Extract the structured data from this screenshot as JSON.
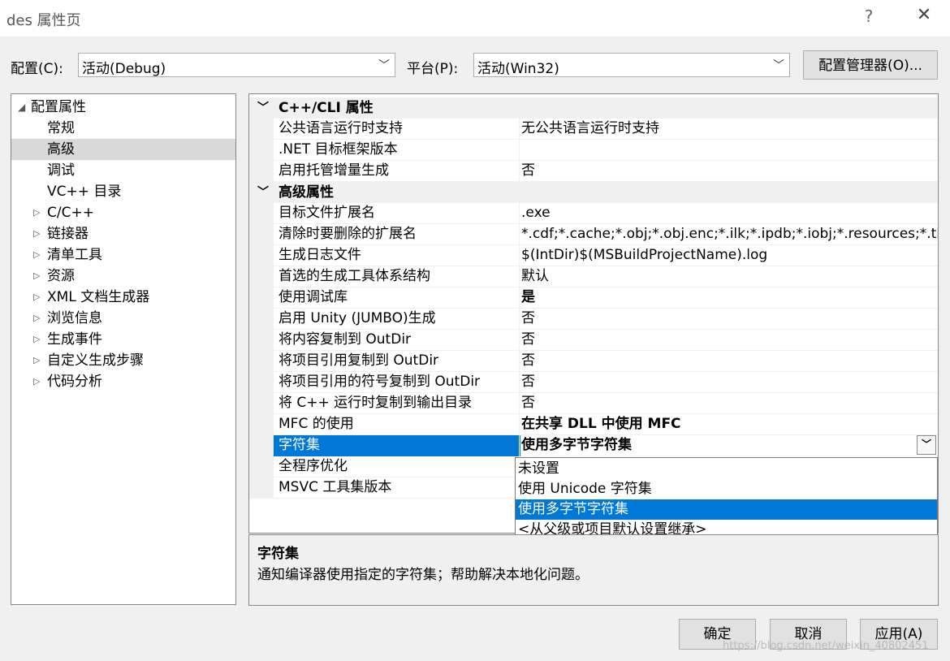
{
  "window": {
    "title": "des 属性页",
    "help_glyph": "?",
    "close_glyph": "✕"
  },
  "config_row": {
    "config_label": "配置(C):",
    "config_value": "活动(Debug)",
    "platform_label": "平台(P):",
    "platform_value": "活动(Win32)",
    "manager_button": "配置管理器(O)..."
  },
  "tree": {
    "root": "配置属性",
    "items": [
      {
        "label": "常规",
        "expandable": false
      },
      {
        "label": "高级",
        "expandable": false,
        "selected": true
      },
      {
        "label": "调试",
        "expandable": false
      },
      {
        "label": "VC++ 目录",
        "expandable": false
      },
      {
        "label": "C/C++",
        "expandable": true
      },
      {
        "label": "链接器",
        "expandable": true
      },
      {
        "label": "清单工具",
        "expandable": true
      },
      {
        "label": "资源",
        "expandable": true
      },
      {
        "label": "XML 文档生成器",
        "expandable": true
      },
      {
        "label": "浏览信息",
        "expandable": true
      },
      {
        "label": "生成事件",
        "expandable": true
      },
      {
        "label": "自定义生成步骤",
        "expandable": true
      },
      {
        "label": "代码分析",
        "expandable": true
      }
    ]
  },
  "grid": {
    "categories": [
      {
        "title": "C++/CLI 属性",
        "rows": [
          {
            "name": "公共语言运行时支持",
            "value": "无公共语言运行时支持"
          },
          {
            "name": ".NET 目标框架版本",
            "value": ""
          },
          {
            "name": "启用托管增量生成",
            "value": "否"
          }
        ]
      },
      {
        "title": "高级属性",
        "rows": [
          {
            "name": "目标文件扩展名",
            "value": ".exe"
          },
          {
            "name": "清除时要删除的扩展名",
            "value": "*.cdf;*.cache;*.obj;*.obj.enc;*.ilk;*.ipdb;*.iobj;*.resources;*.tlb;*.tli;*.tlh;*.tmp;*.rsp"
          },
          {
            "name": "生成日志文件",
            "value": "$(IntDir)$(MSBuildProjectName).log"
          },
          {
            "name": "首选的生成工具体系结构",
            "value": "默认"
          },
          {
            "name": "使用调试库",
            "value": "是",
            "bold": true
          },
          {
            "name": "启用 Unity (JUMBO)生成",
            "value": "否"
          },
          {
            "name": "将内容复制到 OutDir",
            "value": "否"
          },
          {
            "name": "将项目引用复制到 OutDir",
            "value": "否"
          },
          {
            "name": "将项目引用的符号复制到 OutDir",
            "value": "否"
          },
          {
            "name": "将 C++ 运行时复制到输出目录",
            "value": "否"
          },
          {
            "name": "MFC 的使用",
            "value": "在共享 DLL 中使用 MFC",
            "bold": true
          },
          {
            "name": "字符集",
            "value": "使用多字节字符集",
            "selected": true
          },
          {
            "name": "全程序优化",
            "value": ""
          },
          {
            "name": "MSVC 工具集版本",
            "value": ""
          }
        ]
      }
    ],
    "dropdown_glyph": "﹀",
    "collapse_glyph": "﹀"
  },
  "dropdown": {
    "options": [
      "未设置",
      "使用 Unicode 字符集",
      "使用多字节字符集",
      "<从父级或项目默认设置继承>"
    ],
    "selected_index": 2
  },
  "description": {
    "title": "字符集",
    "text": "通知编译器使用指定的字符集；帮助解决本地化问题。"
  },
  "buttons": {
    "ok": "确定",
    "cancel": "取消",
    "apply": "应用(A)"
  },
  "watermark": "https://blog.csdn.net/weixin_40802451",
  "colors": {
    "selection": "#0078d7",
    "tree_selection": "#d9d9d9",
    "dialog_bg": "#f0f0f0"
  }
}
